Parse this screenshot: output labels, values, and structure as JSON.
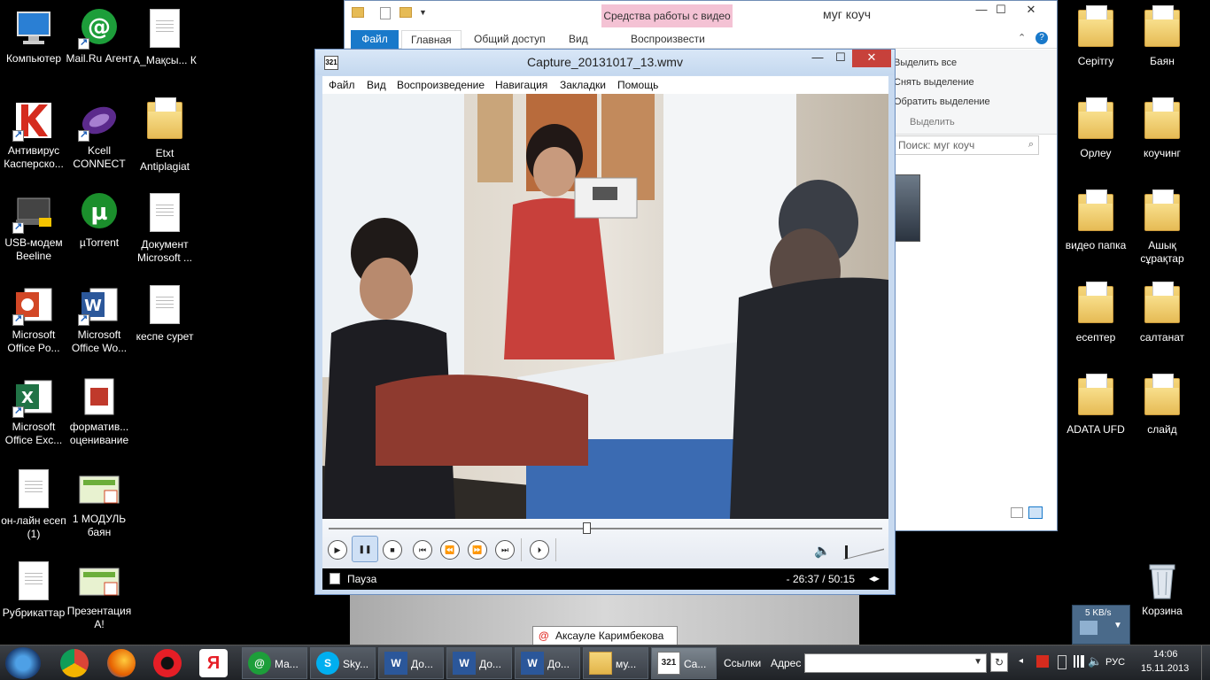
{
  "desktop": {
    "left_icons": [
      {
        "label": "Компьютер",
        "icon": "computer-icon"
      },
      {
        "label": "Mail.Ru Агент",
        "icon": "mailru-agent-icon"
      },
      {
        "label": "А_Мақсы... К",
        "icon": "document-icon"
      },
      {
        "label": "Антивирус Касперско...",
        "icon": "kaspersky-icon"
      },
      {
        "label": "Kcell CONNECT",
        "icon": "kcell-icon"
      },
      {
        "label": "Etxt Antiplagiat",
        "icon": "folder-icon"
      },
      {
        "label": "USB-модем Beeline",
        "icon": "usb-modem-icon"
      },
      {
        "label": "µTorrent",
        "icon": "utorrent-icon"
      },
      {
        "label": "Документ Microsoft ...",
        "icon": "document-icon"
      },
      {
        "label": "Microsoft Office Po...",
        "icon": "powerpoint-icon"
      },
      {
        "label": "Microsoft Office Wo...",
        "icon": "word-icon"
      },
      {
        "label": "кеспе сурет",
        "icon": "document-icon"
      },
      {
        "label": "Microsoft Office Exc...",
        "icon": "excel-icon"
      },
      {
        "label": "форматив... оценивание",
        "icon": "pdf-icon"
      },
      {
        "label": "он-лайн есеп (1)",
        "icon": "document-icon"
      },
      {
        "label": "1 МОДУЛЬ баян",
        "icon": "presentation-icon"
      },
      {
        "label": "Рубрикаттар",
        "icon": "document-icon"
      },
      {
        "label": "Презентация А!",
        "icon": "presentation-icon"
      }
    ],
    "right_icons": [
      {
        "label": "Серітгу",
        "icon": "folder-icon"
      },
      {
        "label": "Баян",
        "icon": "folder-icon"
      },
      {
        "label": "Орлеу",
        "icon": "folder-icon"
      },
      {
        "label": "коучинг",
        "icon": "folder-icon"
      },
      {
        "label": "видео папка",
        "icon": "folder-icon"
      },
      {
        "label": "Ашық сұрақтар",
        "icon": "folder-icon"
      },
      {
        "label": "есептер",
        "icon": "folder-icon"
      },
      {
        "label": "салтанат",
        "icon": "folder-icon"
      },
      {
        "label": "ADATA UFD",
        "icon": "folder-icon"
      },
      {
        "label": "слайд",
        "icon": "folder-icon"
      },
      {
        "label": "Корзина",
        "icon": "recycle-bin-icon"
      }
    ]
  },
  "explorer": {
    "title": "муг коуч",
    "context_tab": "Средства работы с видео",
    "tabs": [
      "Файл",
      "Главная",
      "Общий доступ",
      "Вид",
      "Воспроизвести"
    ],
    "select_group": {
      "items": [
        "Выделить все",
        "Снять выделение",
        "Обратить выделение"
      ],
      "group_label": "Выделить"
    },
    "search_placeholder": "Поиск: муг коуч"
  },
  "player": {
    "title": "Capture_20131017_13.wmv",
    "menu": [
      "Файл",
      "Вид",
      "Воспроизведение",
      "Навигация",
      "Закладки",
      "Помощь"
    ],
    "status": "Пауза",
    "time": "- 26:37 / 50:15",
    "app_icon_text": "321",
    "seek_position": 0.465
  },
  "notification": {
    "text": "Аксауле Каримбекова"
  },
  "taskbar": {
    "windows": [
      {
        "label": "Ма...",
        "icon": "mailru-agent-icon"
      },
      {
        "label": "Sky...",
        "icon": "skype-icon"
      },
      {
        "label": "До...",
        "icon": "word-icon"
      },
      {
        "label": "До...",
        "icon": "word-icon"
      },
      {
        "label": "До...",
        "icon": "word-icon"
      },
      {
        "label": "му...",
        "icon": "folder-icon"
      },
      {
        "label": "Ca...",
        "icon": "media-player-icon"
      }
    ],
    "links_label": "Ссылки",
    "address_label": "Адрес",
    "address_value": "",
    "lang": "РУС",
    "time": "14:06",
    "date": "15.11.2013",
    "net_speed": "5 KB/s"
  }
}
